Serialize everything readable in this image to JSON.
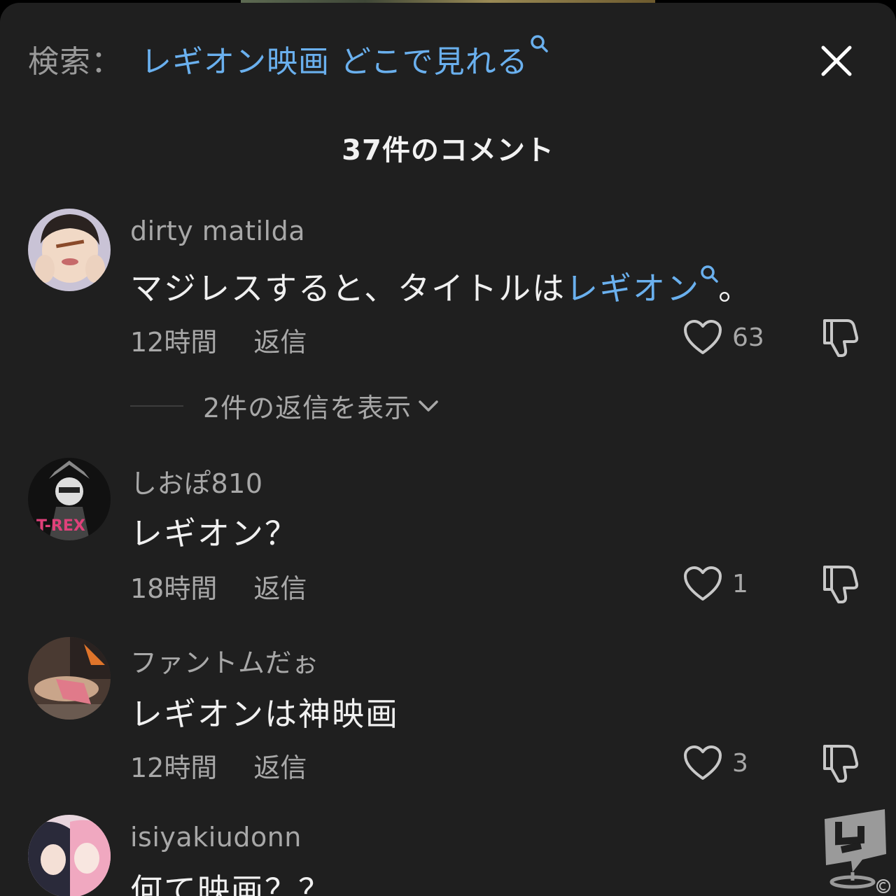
{
  "search": {
    "label": "検索：",
    "query": "レギオン映画 どこで見れる"
  },
  "comments_header": {
    "title": "37件のコメント"
  },
  "comments": [
    {
      "username": "dirty matilda",
      "text_before": "マジレスすると、タイトルは",
      "text_link": "レギオン",
      "text_after": "。",
      "time": "12時間",
      "reply_label": "返信",
      "likes": "63",
      "view_replies": "2件の返信を表示"
    },
    {
      "username": "しおぽ810",
      "text": "レギオン？",
      "time": "18時間",
      "reply_label": "返信",
      "likes": "1"
    },
    {
      "username": "ファントムだぉ",
      "text": "レギオンは神映画",
      "time": "12時間",
      "reply_label": "返信",
      "likes": "3"
    },
    {
      "username": "isiyakiudonn",
      "text": "何て映画？？"
    }
  ],
  "colors": {
    "background": "#1f1f1f",
    "link": "#6ab0ee",
    "muted_text": "#a8a8a8",
    "primary_text": "#f0f0f0"
  },
  "icons": [
    "search-icon",
    "close-icon",
    "heart-icon",
    "dislike-icon",
    "chevron-down-icon",
    "watermark-logo"
  ]
}
